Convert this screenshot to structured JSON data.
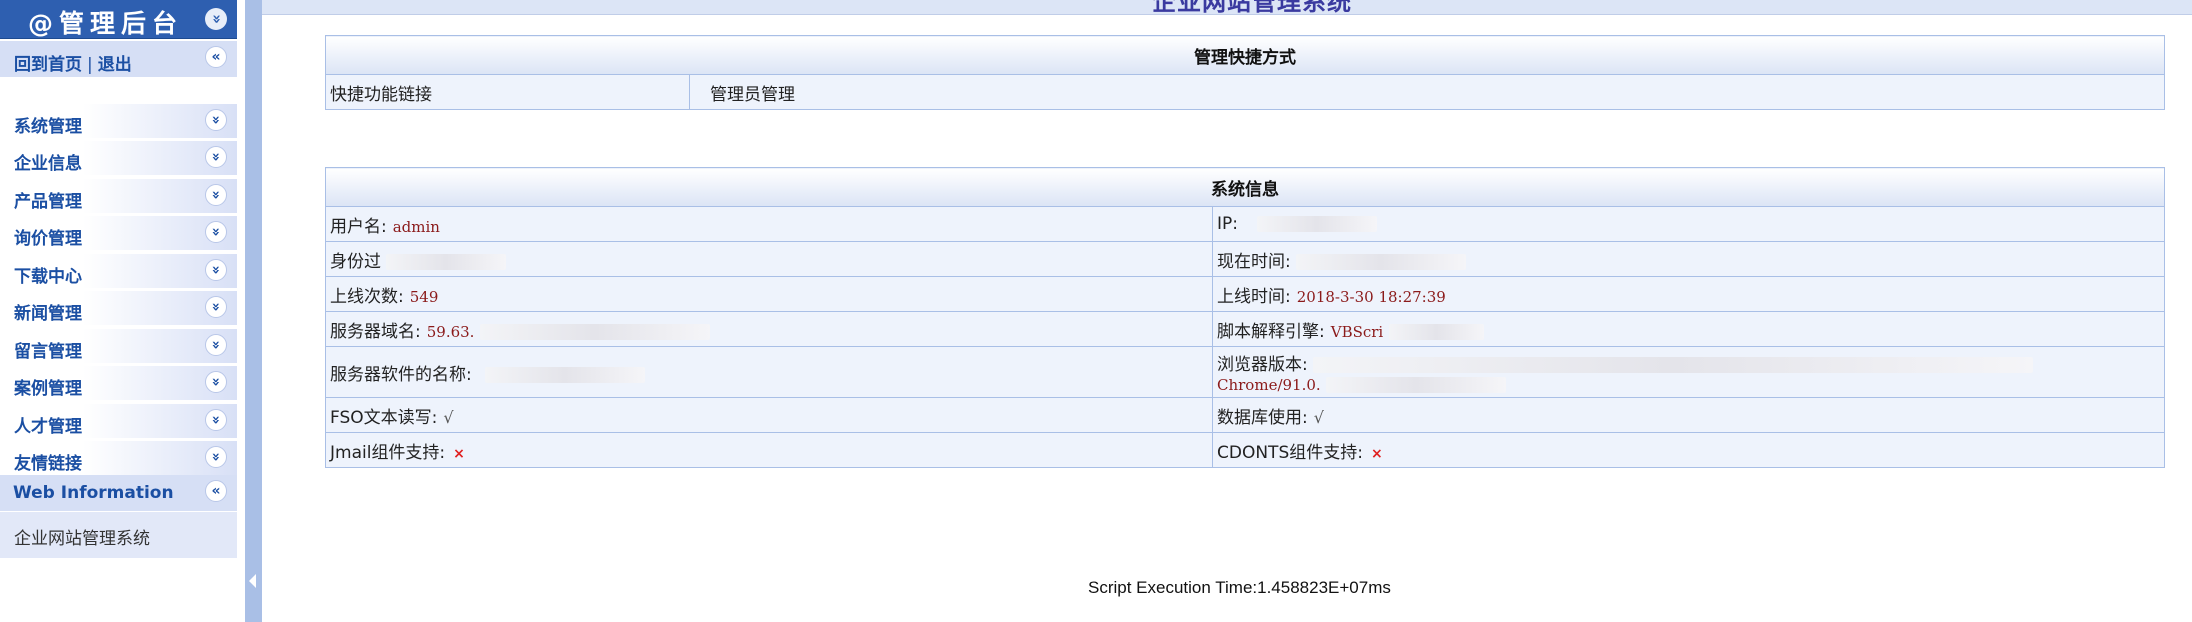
{
  "sidebar": {
    "title": "@管理后台",
    "collapse_icon": "«",
    "home_link": "回到首页",
    "separator": "|",
    "logout_link": "退出",
    "menu": [
      {
        "label": "系统管理"
      },
      {
        "label": "企业信息"
      },
      {
        "label": "产品管理"
      },
      {
        "label": "询价管理"
      },
      {
        "label": "下载中心"
      },
      {
        "label": "新闻管理"
      },
      {
        "label": "留言管理"
      },
      {
        "label": "案例管理"
      },
      {
        "label": "人才管理"
      },
      {
        "label": "友情链接"
      }
    ],
    "web_info_label": "Web Information",
    "web_info_text": "企业网站管理系统"
  },
  "main": {
    "page_title": "企业网站管理系统",
    "shortcuts": {
      "header": "管理快捷方式",
      "label": "快捷功能链接",
      "link": "管理员管理"
    },
    "sysinfo": {
      "header": "系统信息",
      "username_label": "用户名:",
      "username_value": "admin",
      "ip_label": "IP:",
      "identity_label": "身份过",
      "current_time_label": "现在时间:",
      "login_count_label": "上线次数:",
      "login_count_value": "549",
      "login_time_label": "上线时间:",
      "login_time_value": "2018-3-30 18:27:39",
      "server_domain_label": "服务器域名:",
      "server_domain_value": "59.63.",
      "script_engine_label": "脚本解释引擎:",
      "script_engine_value": "VBScri",
      "server_software_label": "服务器软件的名称:",
      "browser_label": "浏览器版本:",
      "browser_value": "Chrome/91.0.",
      "fso_label": "FSO文本读写:",
      "fso_value": "√",
      "db_label": "数据库使用:",
      "db_value": "√",
      "jmail_label": "Jmail组件支持:",
      "jmail_value": "×",
      "cdonts_label": "CDONTS组件支持:",
      "cdonts_value": "×"
    },
    "footer": "Script Execution Time:1.458823E+07ms"
  },
  "colors": {
    "sidebar_header": "#2e5fb0",
    "link_blue": "#1b4fa3",
    "border": "#a9bfe6",
    "value_red": "#8b1a1a"
  }
}
